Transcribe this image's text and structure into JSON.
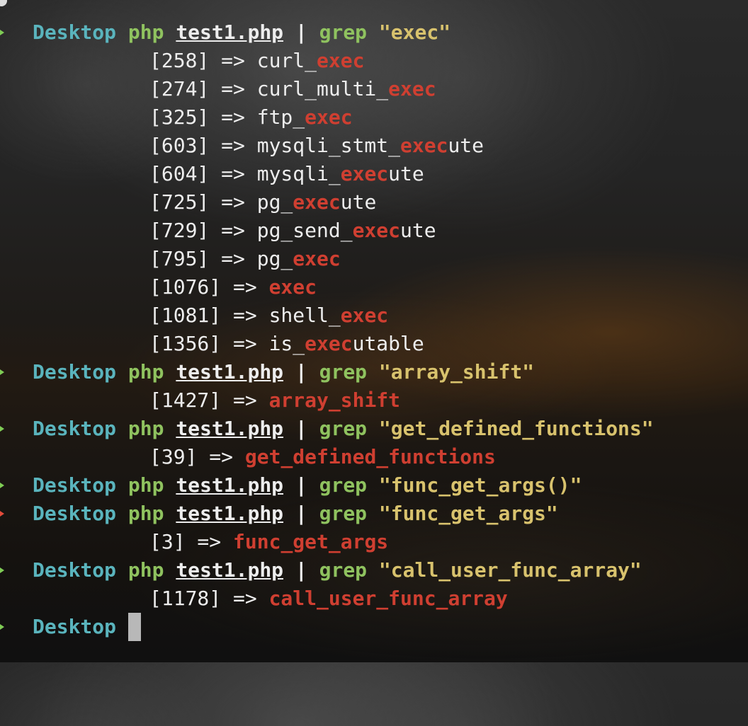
{
  "terminal": {
    "cwd": "Desktop",
    "cursor_cwd": "Desktop",
    "commands": [
      {
        "cmd": "php",
        "file": "test1.php",
        "pipe": "|",
        "grep": "grep",
        "pattern": "\"exec\"",
        "status": "success",
        "results": [
          {
            "index": "[258] =>",
            "before": "curl_",
            "match": "exec",
            "after": ""
          },
          {
            "index": "[274] =>",
            "before": "curl_multi_",
            "match": "exec",
            "after": ""
          },
          {
            "index": "[325] =>",
            "before": "ftp_",
            "match": "exec",
            "after": ""
          },
          {
            "index": "[603] =>",
            "before": "mysqli_stmt_",
            "match": "exec",
            "after": "ute"
          },
          {
            "index": "[604] =>",
            "before": "mysqli_",
            "match": "exec",
            "after": "ute"
          },
          {
            "index": "[725] =>",
            "before": "pg_",
            "match": "exec",
            "after": "ute"
          },
          {
            "index": "[729] =>",
            "before": "pg_send_",
            "match": "exec",
            "after": "ute"
          },
          {
            "index": "[795] =>",
            "before": "pg_",
            "match": "exec",
            "after": ""
          },
          {
            "index": "[1076] =>",
            "before": "",
            "match": "exec",
            "after": ""
          },
          {
            "index": "[1081] =>",
            "before": "shell_",
            "match": "exec",
            "after": ""
          },
          {
            "index": "[1356] =>",
            "before": "is_",
            "match": "exec",
            "after": "utable"
          }
        ]
      },
      {
        "cmd": "php",
        "file": "test1.php",
        "pipe": "|",
        "grep": "grep",
        "pattern": "\"array_shift\"",
        "status": "success",
        "results": [
          {
            "index": "[1427] =>",
            "before": "",
            "match": "array_shift",
            "after": ""
          }
        ]
      },
      {
        "cmd": "php",
        "file": "test1.php",
        "pipe": "|",
        "grep": "grep",
        "pattern": "\"get_defined_functions\"",
        "status": "success",
        "results": [
          {
            "index": "[39] =>",
            "before": "",
            "match": "get_defined_functions",
            "after": ""
          }
        ]
      },
      {
        "cmd": "php",
        "file": "test1.php",
        "pipe": "|",
        "grep": "grep",
        "pattern": "\"func_get_args()\"",
        "status": "success",
        "results": []
      },
      {
        "cmd": "php",
        "file": "test1.php",
        "pipe": "|",
        "grep": "grep",
        "pattern": "\"func_get_args\"",
        "status": "error",
        "results": [
          {
            "index": "[3] =>",
            "before": "",
            "match": "func_get_args",
            "after": ""
          }
        ]
      },
      {
        "cmd": "php",
        "file": "test1.php",
        "pipe": "|",
        "grep": "grep",
        "pattern": "\"call_user_func_array\"",
        "status": "success",
        "results": [
          {
            "index": "[1178] =>",
            "before": "",
            "match": "call_user_func_array",
            "after": ""
          }
        ]
      }
    ]
  },
  "colors": {
    "prompt_success": "#7fcc55",
    "prompt_error": "#e34b3a",
    "cwd": "#5ab4bd",
    "command": "#8fc25f",
    "pattern": "#d8c26d",
    "match": "#cf3f31",
    "text": "#ededed",
    "cursor": "#b8b8b8"
  }
}
